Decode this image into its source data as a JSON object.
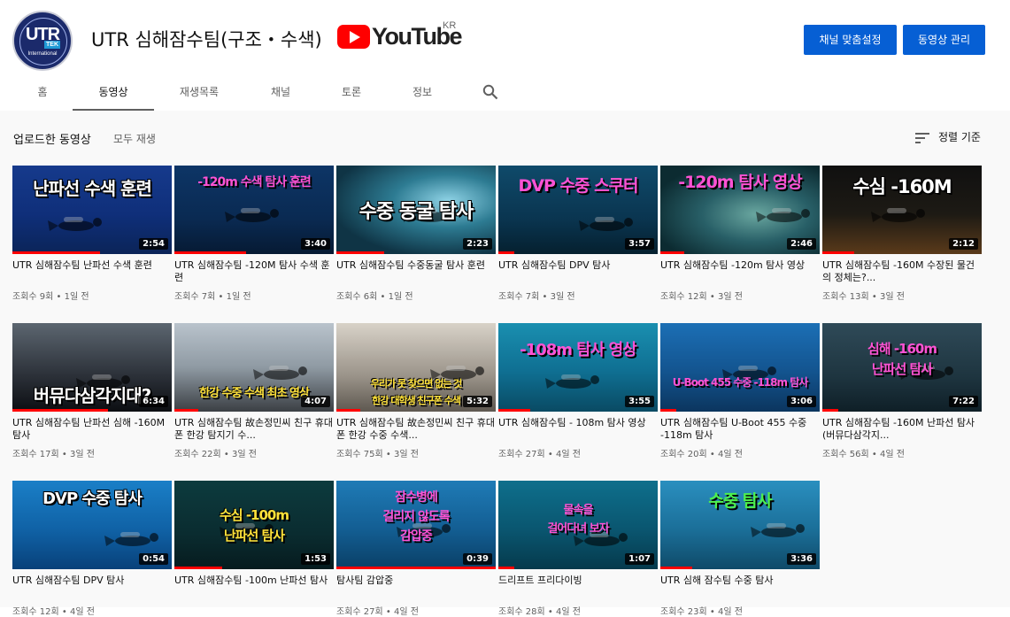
{
  "channel": {
    "name": "UTR 심해잠수팀(구조・수색)",
    "avatar_text": "UTR",
    "avatar_badge": "TEK",
    "avatar_sub": "International",
    "youtube_logo": "YouTube",
    "region": "KR",
    "buttons": {
      "customize": "채널 맞춤설정",
      "manage": "동영상 관리"
    }
  },
  "tabs": [
    {
      "label": "홈",
      "active": false
    },
    {
      "label": "동영상",
      "active": true
    },
    {
      "label": "재생목록",
      "active": false
    },
    {
      "label": "채널",
      "active": false
    },
    {
      "label": "토론",
      "active": false
    },
    {
      "label": "정보",
      "active": false
    }
  ],
  "section": {
    "title": "업로드한 동영상",
    "play_all": "모두 재생",
    "sort_label": "정렬 기준"
  },
  "colors": {
    "accent": "#065fd4",
    "progress": "#ff0000"
  },
  "videos": [
    {
      "thumb_text": "난파선 수색 훈련",
      "duration": "2:54",
      "title": "UTR 심해잠수팀 난파선 수색 훈련",
      "views": "조회수 9회",
      "age": "1일 전",
      "watched": 0.55
    },
    {
      "thumb_text": "-120m 수색 탐사 훈련",
      "duration": "3:40",
      "title": "UTR 심해잠수팀 -120M 탐사 수색 훈련",
      "views": "조회수 7회",
      "age": "1일 전",
      "watched": 0.45
    },
    {
      "thumb_text": "수중 동굴 탐사",
      "duration": "2:23",
      "title": "UTR 심해잠수팀 수중동굴 탐사 훈련",
      "views": "조회수 6회",
      "age": "1일 전",
      "watched": 0.3
    },
    {
      "thumb_text": "DVP 수중 스쿠터",
      "duration": "3:57",
      "title": "UTR 심해잠수팀 DPV 탐사",
      "views": "조회수 7회",
      "age": "3일 전",
      "watched": 0.1
    },
    {
      "thumb_text": "-120m 탐사 영상",
      "duration": "2:46",
      "title": "UTR 심해잠수팀 -120m 탐사 영상",
      "views": "조회수 12회",
      "age": "3일 전",
      "watched": 0.15
    },
    {
      "thumb_text": "수심 -160M",
      "duration": "2:12",
      "title": "UTR 심해잠수팀 -160M 수장된 물건의 정체는?...",
      "views": "조회수 13회",
      "age": "3일 전",
      "watched": 0.2
    },
    {
      "thumb_text": "버뮤다삼각지대?",
      "duration": "6:34",
      "title": "UTR 심해잠수팀 난파선 심해 -160M 탐사",
      "views": "조회수 17회",
      "age": "3일 전",
      "watched": 0.6
    },
    {
      "thumb_text": "한강 수중 수색 최초 영상",
      "duration": "4:07",
      "title": "UTR 심해잠수팀 故손정민씨 친구 휴대폰 한강 탐지기 수...",
      "views": "조회수 22회",
      "age": "3일 전",
      "watched": 0.15
    },
    {
      "thumb_text": "우리가 못 찾으면 없는 것|한강 대학생 친구폰 수색",
      "duration": "5:32",
      "title": "UTR 심해잠수팀 故손정민씨 친구 휴대폰 한강 수중 수색...",
      "views": "조회수 75회",
      "age": "3일 전",
      "watched": 0.15
    },
    {
      "thumb_text": "-108m 탐사 영상",
      "duration": "3:55",
      "title": "UTR 심해잠수팀 - 108m 탐사 영상",
      "views": "조회수 27회",
      "age": "4일 전",
      "watched": 0.2
    },
    {
      "thumb_text": "U-Boot 455 수중 -118m 탐사",
      "duration": "3:06",
      "title": "UTR 심해잠수팀 U-Boot 455 수중 -118m 탐사",
      "views": "조회수 20회",
      "age": "4일 전",
      "watched": 0.1
    },
    {
      "thumb_text": "심해 -160m|난파선 탐사",
      "duration": "7:22",
      "title": "UTR 심해잠수팀 -160M 난파선 탐사 (버뮤다삼각지...",
      "views": "조회수 56회",
      "age": "4일 전",
      "watched": 0.1
    },
    {
      "thumb_text": "DVP 수중 탐사",
      "duration": "0:54",
      "title": "UTR 심해잠수팀 DPV 탐사",
      "views": "조회수 12회",
      "age": "4일 전",
      "watched": 0.0
    },
    {
      "thumb_text": "수심 -100m|난파선 탐사",
      "duration": "1:53",
      "title": "UTR 심해잠수팀 -100m 난파선 탐사",
      "views": "",
      "age": "",
      "watched": 0.3
    },
    {
      "thumb_text": "잠수병에|걸리지 않도록|감압중",
      "duration": "0:39",
      "title": "탐사팀 감압중",
      "views": "조회수 27회",
      "age": "4일 전",
      "watched": 1.0
    },
    {
      "thumb_text": "물속을|걸어다녀 보자",
      "duration": "1:07",
      "title": "드리프트 프리다이빙",
      "views": "조회수 28회",
      "age": "4일 전",
      "watched": 0.1
    },
    {
      "thumb_text": "수중 탐사",
      "duration": "3:36",
      "title": "UTR 심해 잠수팀 수중 탐사",
      "views": "조회수 23회",
      "age": "4일 전",
      "watched": 0.2
    }
  ]
}
